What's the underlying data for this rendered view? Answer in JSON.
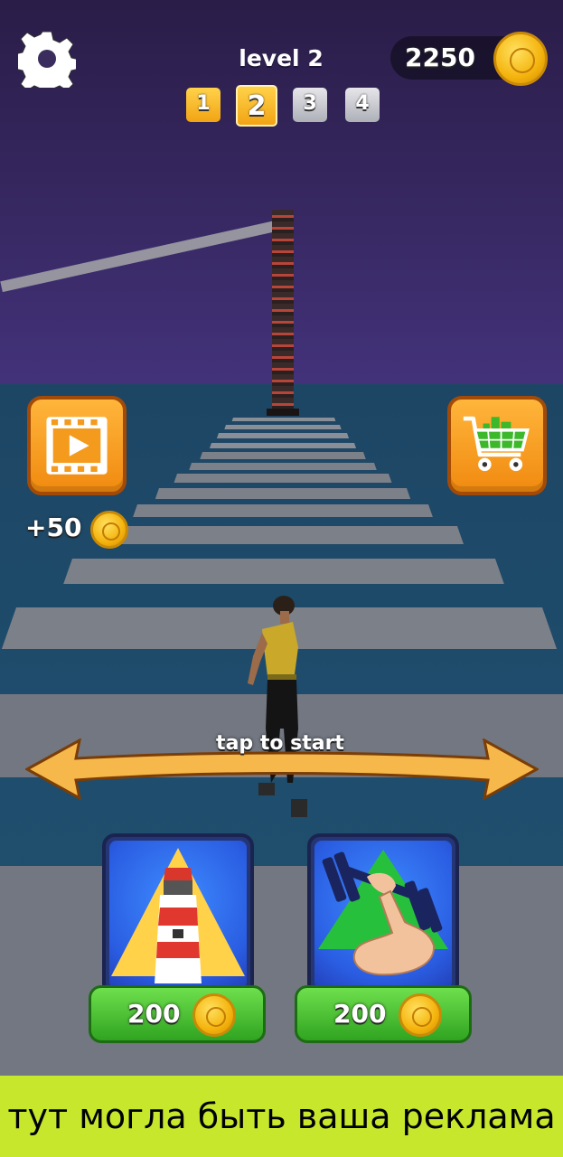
{
  "hud": {
    "level_title": "level 2",
    "levels": [
      "1",
      "2",
      "3",
      "4"
    ],
    "current_level_index": 1,
    "balance": "2250"
  },
  "buttons": {
    "watch_video_reward": "+50",
    "shop_icon": "shopping-cart-icon",
    "video_icon": "play-video-icon",
    "settings_icon": "gear-icon"
  },
  "start_prompt": "tap to start",
  "upgrades": [
    {
      "icon": "lighthouse-icon",
      "price": "200"
    },
    {
      "icon": "strength-dumbbell-icon",
      "price": "200"
    }
  ],
  "ad_banner": "тут могла быть ваша реклама",
  "colors": {
    "accent_orange": "#f7a125",
    "coin_gold": "#f4b30d",
    "price_green": "#3bb42a",
    "banner_lime": "#c6e72c"
  }
}
